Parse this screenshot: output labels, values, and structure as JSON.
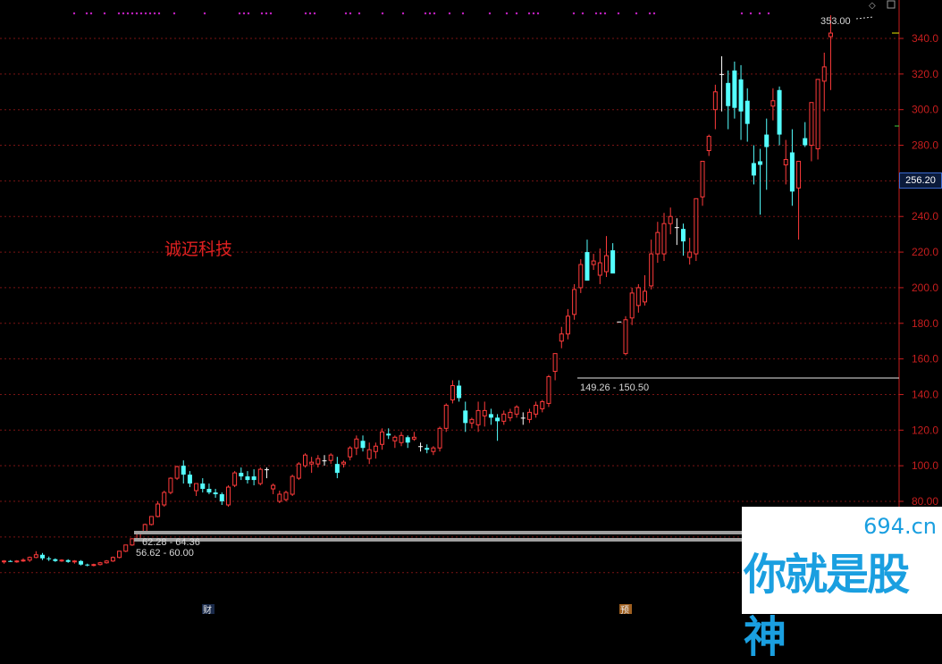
{
  "stock_name": "诚迈科技",
  "watermark": {
    "url": "694.cn",
    "text": "你就是股神"
  },
  "current_price": "256.20",
  "annotations": {
    "high": "353.00",
    "gap1": "149.26 - 150.50",
    "gap2": "62.28 - 64.36",
    "gap3": "56.62 - 60.00"
  },
  "bottom_markers": [
    "财",
    "预"
  ],
  "colors": {
    "up": "#ff3b3b",
    "down": "#54ffff",
    "flat": "#ffffff",
    "axis": "#c81e1e",
    "grid": "#7a1414"
  },
  "chart_data": {
    "type": "candlestick",
    "ylim": [
      35,
      355
    ],
    "y_ticks": [
      "80.00",
      "100.0",
      "120.0",
      "140.0",
      "160.0",
      "180.0",
      "200.0",
      "220.0",
      "240.0",
      "260.0",
      "280.0",
      "300.0",
      "320.0",
      "340.0"
    ],
    "candles": [
      [
        46,
        47,
        45,
        46.5
      ],
      [
        46.5,
        47,
        46,
        46
      ],
      [
        46,
        47,
        45.5,
        46.5
      ],
      [
        46.5,
        48,
        46,
        47
      ],
      [
        47,
        49,
        46,
        48.5
      ],
      [
        48.5,
        52,
        48,
        50
      ],
      [
        50,
        51,
        47,
        48
      ],
      [
        48,
        49,
        46.5,
        47.5
      ],
      [
        47.5,
        48,
        46,
        46.5
      ],
      [
        46.5,
        47.5,
        46,
        47
      ],
      [
        47,
        47.5,
        45.5,
        46
      ],
      [
        46,
        47,
        45,
        46.5
      ],
      [
        46.5,
        47,
        44,
        44.5
      ],
      [
        44.5,
        45,
        43.5,
        44
      ],
      [
        44,
        45,
        43.5,
        44.5
      ],
      [
        44.5,
        46,
        44,
        45.5
      ],
      [
        45.5,
        47,
        45,
        46.5
      ],
      [
        46.5,
        49,
        46,
        48.5
      ],
      [
        48.5,
        52,
        48,
        52
      ],
      [
        52,
        55.5,
        51.5,
        55.5
      ],
      [
        55.5,
        59,
        55,
        59
      ],
      [
        59,
        62.5,
        58.5,
        62.5
      ],
      [
        62.5,
        67.5,
        62,
        67
      ],
      [
        67,
        71.5,
        66.5,
        71.5
      ],
      [
        71.5,
        80,
        71,
        78.5
      ],
      [
        78,
        86,
        77,
        85
      ],
      [
        85,
        93.5,
        84,
        93
      ],
      [
        93,
        100,
        92,
        99.5
      ],
      [
        100,
        103,
        90,
        95
      ],
      [
        95,
        97,
        88,
        90
      ],
      [
        86,
        90,
        83,
        90
      ],
      [
        90,
        93,
        85,
        87
      ],
      [
        87,
        90,
        84,
        85
      ],
      [
        85,
        87,
        82,
        84
      ],
      [
        84,
        85,
        78,
        80
      ],
      [
        78,
        89,
        77,
        88
      ],
      [
        89,
        97,
        88,
        96
      ],
      [
        96,
        99,
        92,
        94
      ],
      [
        94,
        97,
        90,
        92
      ],
      [
        94,
        98,
        89,
        92
      ],
      [
        90,
        99,
        89,
        98
      ],
      [
        98,
        99,
        93,
        98
      ],
      [
        87,
        90,
        84,
        89
      ],
      [
        80,
        86,
        79,
        84
      ],
      [
        81,
        86,
        80,
        85
      ],
      [
        84,
        95,
        83,
        94
      ],
      [
        93,
        102,
        92,
        101
      ],
      [
        100,
        107,
        99,
        106
      ],
      [
        101,
        105,
        96,
        102
      ],
      [
        101,
        106,
        99,
        104
      ],
      [
        103,
        106,
        100,
        103
      ],
      [
        103,
        107,
        101,
        106
      ],
      [
        101,
        105,
        93,
        96
      ],
      [
        101,
        103,
        99,
        102
      ],
      [
        105,
        111,
        103,
        110
      ],
      [
        110,
        117,
        106,
        115
      ],
      [
        114,
        117,
        108,
        110
      ],
      [
        104,
        113,
        101,
        109
      ],
      [
        108,
        113,
        104,
        111
      ],
      [
        112,
        121,
        109,
        119
      ],
      [
        118,
        121,
        115,
        117
      ],
      [
        114,
        117,
        110,
        116
      ],
      [
        113,
        119,
        111,
        117
      ],
      [
        116,
        117,
        110,
        113
      ],
      [
        115,
        119,
        114,
        116
      ],
      [
        111,
        113,
        108,
        111
      ],
      [
        110,
        112,
        107,
        109
      ],
      [
        108,
        111,
        106,
        110
      ],
      [
        110,
        122,
        108,
        121
      ],
      [
        121,
        135,
        119,
        134
      ],
      [
        137,
        148,
        135,
        145
      ],
      [
        145,
        148,
        136,
        138
      ],
      [
        131,
        136,
        119,
        124
      ],
      [
        124,
        127,
        121,
        126
      ],
      [
        123,
        136,
        119,
        131
      ],
      [
        128,
        136,
        122,
        131
      ],
      [
        129,
        132,
        123,
        127
      ],
      [
        127,
        129,
        114,
        125
      ],
      [
        125,
        131,
        123,
        129
      ],
      [
        127,
        132,
        125,
        130
      ],
      [
        129,
        134,
        127,
        133
      ],
      [
        127,
        130,
        123,
        127
      ],
      [
        126,
        132,
        124,
        130
      ],
      [
        129,
        136,
        127,
        134
      ],
      [
        132,
        137,
        130,
        136
      ],
      [
        135,
        151,
        133,
        150
      ],
      [
        153,
        163,
        148,
        163
      ],
      [
        170,
        178,
        166,
        174
      ],
      [
        174,
        188,
        171,
        184
      ],
      [
        185,
        202,
        182,
        199
      ],
      [
        200,
        216,
        197,
        213
      ],
      [
        220,
        227,
        205,
        204
      ],
      [
        213,
        219,
        210,
        215
      ],
      [
        207,
        222,
        202,
        214
      ],
      [
        209,
        229,
        206,
        218
      ],
      [
        221,
        225,
        208,
        208
      ],
      [
        181,
        181,
        181,
        181
      ],
      [
        163,
        184,
        162,
        182
      ],
      [
        183,
        200,
        179,
        197
      ],
      [
        190,
        202,
        186,
        200
      ],
      [
        192,
        207,
        190,
        198
      ],
      [
        201,
        227,
        199,
        219
      ],
      [
        219,
        237,
        214,
        231
      ],
      [
        219,
        242,
        215,
        236
      ],
      [
        236,
        245,
        230,
        240
      ],
      [
        234,
        239,
        224,
        234
      ],
      [
        233,
        236,
        218,
        226
      ],
      [
        217,
        228,
        213,
        220
      ],
      [
        219,
        247,
        215,
        250
      ],
      [
        251,
        268,
        246,
        271
      ],
      [
        277,
        286,
        274,
        285
      ],
      [
        300,
        314,
        289,
        310
      ],
      [
        320,
        330,
        299,
        320
      ],
      [
        315,
        322,
        289,
        302
      ],
      [
        322,
        327,
        295,
        301
      ],
      [
        317,
        325,
        283,
        299
      ],
      [
        305,
        312,
        282,
        292
      ],
      [
        270,
        280,
        258,
        263
      ],
      [
        271,
        278,
        241,
        269
      ],
      [
        286,
        295,
        255,
        279
      ],
      [
        302,
        312,
        294,
        305
      ],
      [
        311,
        313,
        280,
        286
      ],
      [
        269,
        283,
        258,
        272
      ],
      [
        276,
        289,
        246,
        254
      ],
      [
        256,
        270,
        227,
        271
      ],
      [
        284,
        293,
        279,
        280
      ],
      [
        280,
        301,
        271,
        304
      ],
      [
        278,
        316,
        272,
        317
      ],
      [
        316,
        332,
        299,
        324
      ],
      [
        341,
        353,
        311,
        343
      ]
    ]
  }
}
